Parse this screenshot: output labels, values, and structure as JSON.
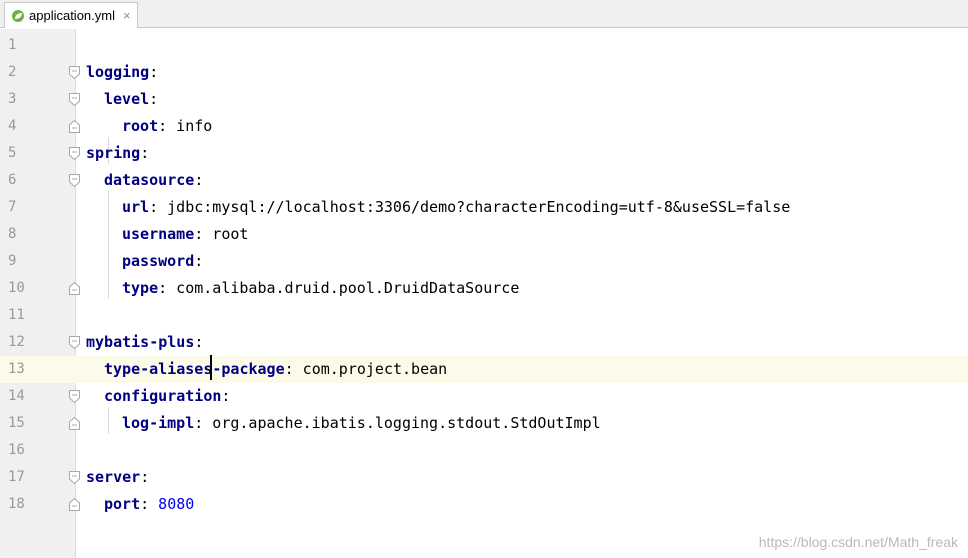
{
  "tab": {
    "icon": "spring-leaf-icon",
    "label": "application.yml",
    "close": "×"
  },
  "lines": [
    {
      "n": "1"
    },
    {
      "n": "2",
      "key": "logging",
      "colon": ":"
    },
    {
      "n": "3",
      "key": "level",
      "colon": ":"
    },
    {
      "n": "4",
      "key": "root",
      "colon": ":",
      "val": " info"
    },
    {
      "n": "5",
      "key": "spring",
      "colon": ":"
    },
    {
      "n": "6",
      "key": "datasource",
      "colon": ":"
    },
    {
      "n": "7",
      "key": "url",
      "colon": ":",
      "val": " jdbc:mysql://localhost:3306/demo?characterEncoding=utf-8&useSSL=false"
    },
    {
      "n": "8",
      "key": "username",
      "colon": ":",
      "val": " root"
    },
    {
      "n": "9",
      "key": "password",
      "colon": ":"
    },
    {
      "n": "10",
      "key": "type",
      "colon": ":",
      "val": " com.alibaba.druid.pool.DruidDataSource"
    },
    {
      "n": "11"
    },
    {
      "n": "12",
      "key": "mybatis-plus",
      "colon": ":"
    },
    {
      "n": "13",
      "key": "type-aliases-package",
      "colon": ":",
      "val": " com.project.bean"
    },
    {
      "n": "14",
      "key": "configuration",
      "colon": ":"
    },
    {
      "n": "15",
      "key": "log-impl",
      "colon": ":",
      "val": " org.apache.ibatis.logging.stdout.StdOutImpl"
    },
    {
      "n": "16"
    },
    {
      "n": "17",
      "key": "server",
      "colon": ":"
    },
    {
      "n": "18",
      "key": "port",
      "colon": ":",
      "num": " 8080"
    }
  ],
  "watermark": "https://blog.csdn.net/Math_freak",
  "colors": {
    "key": "#000080",
    "number": "#0000ff",
    "current_line": "#fcfae9",
    "gutter": "#f0f0f0"
  }
}
